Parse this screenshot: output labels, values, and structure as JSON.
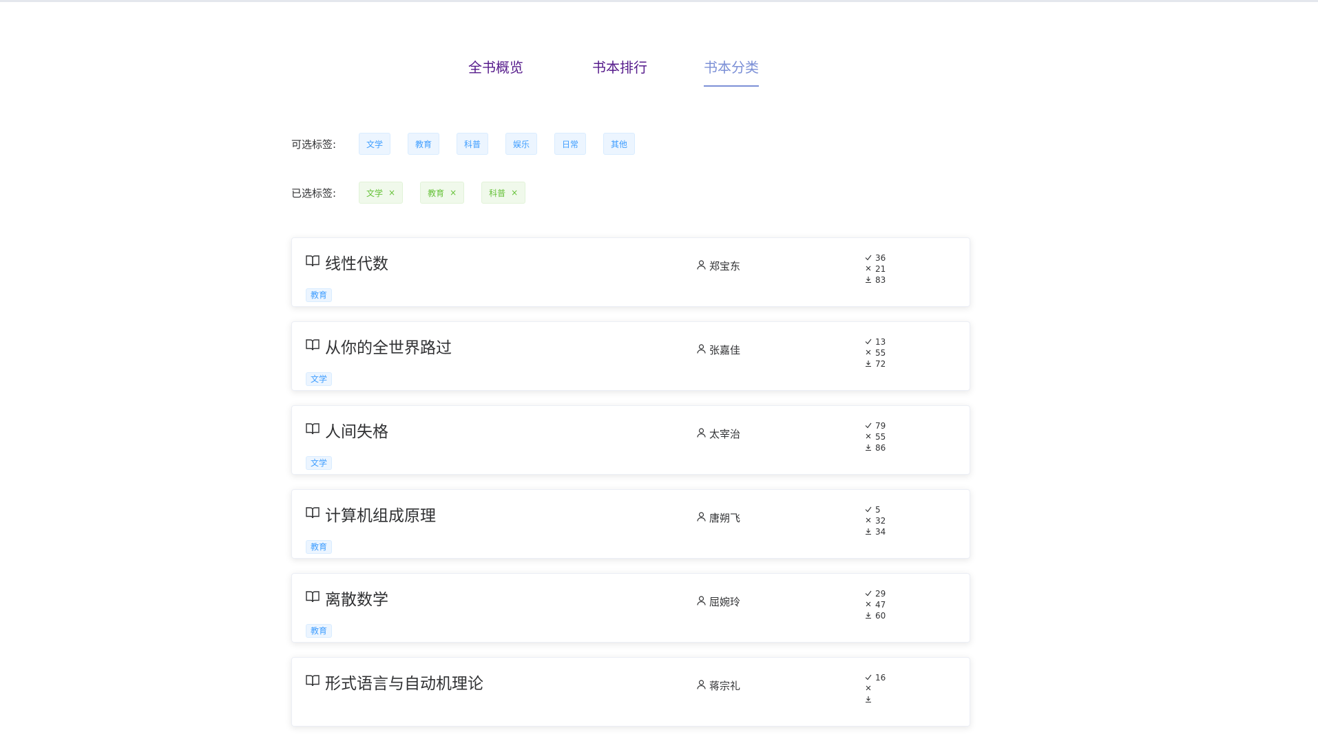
{
  "tabs": [
    {
      "label": "全书概览"
    },
    {
      "label": "书本排行"
    },
    {
      "label": "书本分类"
    }
  ],
  "active_tab": 2,
  "available_tags": {
    "label": "可选标签:",
    "items": [
      "文学",
      "教育",
      "科普",
      "娱乐",
      "日常",
      "其他"
    ]
  },
  "selected_tags": {
    "label": "已选标签:",
    "items": [
      "文学",
      "教育",
      "科普"
    ],
    "close_icon": "×"
  },
  "books": [
    {
      "title": "线性代数",
      "category": "教育",
      "author": "郑宝东",
      "likes": "36",
      "dislikes": "21",
      "downloads": "83"
    },
    {
      "title": "从你的全世界路过",
      "category": "文学",
      "author": "张嘉佳",
      "likes": "13",
      "dislikes": "55",
      "downloads": "72"
    },
    {
      "title": "人间失格",
      "category": "文学",
      "author": "太宰治",
      "likes": "79",
      "dislikes": "55",
      "downloads": "86"
    },
    {
      "title": "计算机组成原理",
      "category": "教育",
      "author": "唐朔飞",
      "likes": "5",
      "dislikes": "32",
      "downloads": "34"
    },
    {
      "title": "离散数学",
      "category": "教育",
      "author": "屈婉玲",
      "likes": "29",
      "dislikes": "47",
      "downloads": "60"
    },
    {
      "title": "形式语言与自动机理论",
      "category": "",
      "author": "蒋宗礼",
      "likes": "16",
      "dislikes": "",
      "downloads": ""
    }
  ],
  "icons": {
    "book": "book-icon",
    "user": "user-icon",
    "like": "check-icon",
    "dislike": "cross-icon",
    "download": "download-icon"
  },
  "colors": {
    "tab_link": "#551a8b",
    "tab_active": "#7b8fd6",
    "tag_blue": "#409eff",
    "tag_green": "#67c23a"
  }
}
